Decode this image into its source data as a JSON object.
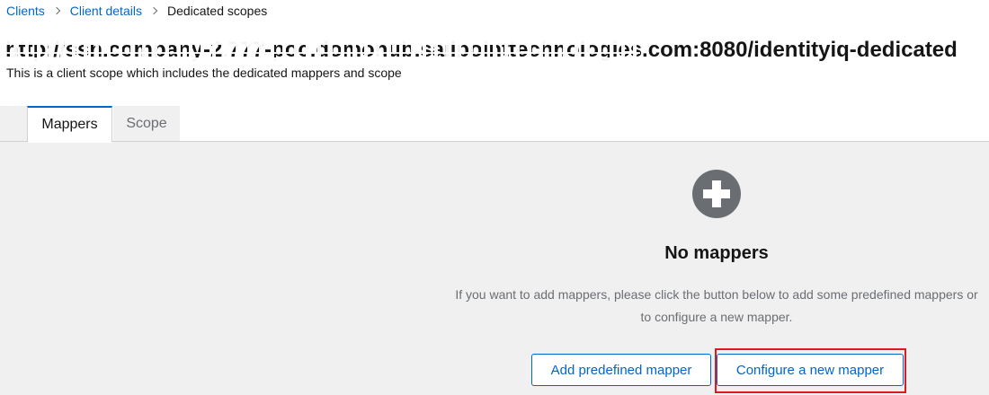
{
  "breadcrumb": {
    "items": [
      "Clients",
      "Client details"
    ],
    "current": "Dedicated scopes"
  },
  "header": {
    "title": "http://ssn.company-2.777-poc.domonub.sailpointtechnologies.com:8080/identityiq-dedicated",
    "subtitle": "This is a client scope which includes the dedicated mappers and scope"
  },
  "tabs": [
    {
      "label": "Mappers",
      "active": true
    },
    {
      "label": "Scope",
      "active": false
    }
  ],
  "empty_state": {
    "icon": "plus-circle-icon",
    "title": "No mappers",
    "body": "If you want to add mappers, please click the button below to add some predefined mappers or to configure a new mapper."
  },
  "actions": {
    "add_predefined": "Add predefined mapper",
    "configure_new": "Configure a new mapper"
  },
  "colors": {
    "link": "#0066cc",
    "active_tab_border": "#0066cc",
    "highlight": "#e0191f",
    "icon": "#6a6e73"
  }
}
